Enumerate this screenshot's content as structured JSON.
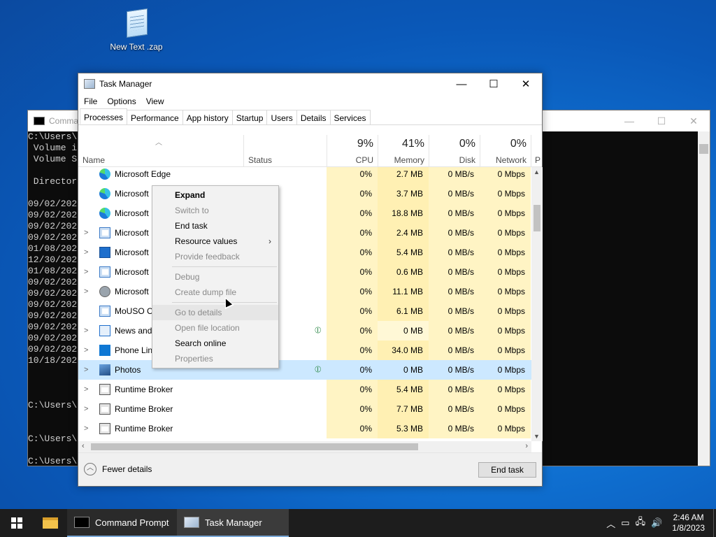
{
  "desktop": {
    "icon_label": "New Text .zap"
  },
  "cmd": {
    "title": "Comma",
    "lines": [
      "C:\\Users\\",
      " Volume i",
      " Volume S",
      "",
      " Director",
      "",
      "09/02/202",
      "09/02/202",
      "09/02/202",
      "09/02/202",
      "01/08/202",
      "12/30/202",
      "01/08/202",
      "09/02/202",
      "09/02/202",
      "09/02/202",
      "09/02/202",
      "09/02/202",
      "09/02/202",
      "09/02/202",
      "10/18/202",
      "",
      "",
      "",
      "C:\\Users\\",
      "",
      "",
      "C:\\Users\\",
      "",
      "C:\\Users\\"
    ]
  },
  "taskmanager": {
    "title": "Task Manager",
    "menu": [
      "File",
      "Options",
      "View"
    ],
    "tabs": [
      "Processes",
      "Performance",
      "App history",
      "Startup",
      "Users",
      "Details",
      "Services"
    ],
    "columns": {
      "name": "Name",
      "status": "Status",
      "cpu_pct": "9%",
      "cpu": "CPU",
      "mem_pct": "41%",
      "mem": "Memory",
      "disk_pct": "0%",
      "disk": "Disk",
      "net_pct": "0%",
      "net": "Network",
      "power": "P"
    },
    "rows": [
      {
        "name": "Microsoft Edge",
        "icon": "edge-icon",
        "expand": false,
        "leaf": false,
        "cpu": "0%",
        "mem": "2.7 MB",
        "disk": "0 MB/s",
        "net": "0 Mbps"
      },
      {
        "name": "Microsoft",
        "icon": "edge-icon",
        "expand": false,
        "leaf": false,
        "cpu": "0%",
        "mem": "3.7 MB",
        "disk": "0 MB/s",
        "net": "0 Mbps"
      },
      {
        "name": "Microsoft",
        "icon": "edge-icon",
        "expand": false,
        "leaf": false,
        "cpu": "0%",
        "mem": "18.8 MB",
        "disk": "0 MB/s",
        "net": "0 Mbps"
      },
      {
        "name": "Microsoft",
        "icon": "window-icon",
        "expand": true,
        "leaf": false,
        "cpu": "0%",
        "mem": "2.4 MB",
        "disk": "0 MB/s",
        "net": "0 Mbps"
      },
      {
        "name": "Microsoft",
        "icon": "keyboard-icon",
        "expand": true,
        "leaf": false,
        "cpu": "0%",
        "mem": "5.4 MB",
        "disk": "0 MB/s",
        "net": "0 Mbps"
      },
      {
        "name": "Microsoft",
        "icon": "window-icon",
        "expand": true,
        "leaf": false,
        "cpu": "0%",
        "mem": "0.6 MB",
        "disk": "0 MB/s",
        "net": "0 Mbps"
      },
      {
        "name": "Microsoft",
        "icon": "user-icon",
        "expand": true,
        "leaf": false,
        "cpu": "0%",
        "mem": "11.1 MB",
        "disk": "0 MB/s",
        "net": "0 Mbps"
      },
      {
        "name": "MoUSO C",
        "icon": "window-icon",
        "expand": false,
        "leaf": false,
        "cpu": "0%",
        "mem": "6.1 MB",
        "disk": "0 MB/s",
        "net": "0 Mbps"
      },
      {
        "name": "News and",
        "icon": "search-icon",
        "expand": true,
        "leaf": true,
        "cpu": "0%",
        "mem": "0 MB",
        "disk": "0 MB/s",
        "net": "0 Mbps"
      },
      {
        "name": "Phone Lin",
        "icon": "phone-icon",
        "expand": true,
        "leaf": false,
        "cpu": "0%",
        "mem": "34.0 MB",
        "disk": "0 MB/s",
        "net": "0 Mbps"
      },
      {
        "name": "Photos",
        "icon": "photos-icon",
        "expand": true,
        "leaf": true,
        "cpu": "0%",
        "mem": "0 MB",
        "disk": "0 MB/s",
        "net": "0 Mbps"
      },
      {
        "name": "Runtime Broker",
        "icon": "runtime-icon",
        "expand": true,
        "leaf": false,
        "cpu": "0%",
        "mem": "5.4 MB",
        "disk": "0 MB/s",
        "net": "0 Mbps"
      },
      {
        "name": "Runtime Broker",
        "icon": "runtime-icon",
        "expand": true,
        "leaf": false,
        "cpu": "0%",
        "mem": "7.7 MB",
        "disk": "0 MB/s",
        "net": "0 Mbps"
      },
      {
        "name": "Runtime Broker",
        "icon": "runtime-icon",
        "expand": true,
        "leaf": false,
        "cpu": "0%",
        "mem": "5.3 MB",
        "disk": "0 MB/s",
        "net": "0 Mbps"
      }
    ],
    "selected_row": "Photos",
    "fewer_details": "Fewer details",
    "end_task": "End task"
  },
  "context_menu": {
    "items": [
      {
        "label": "Expand",
        "enabled": true,
        "bold": true
      },
      {
        "label": "Switch to",
        "enabled": false
      },
      {
        "label": "End task",
        "enabled": true
      },
      {
        "label": "Resource values",
        "enabled": true,
        "submenu": true
      },
      {
        "label": "Provide feedback",
        "enabled": false
      },
      {
        "separator": true
      },
      {
        "label": "Debug",
        "enabled": false
      },
      {
        "label": "Create dump file",
        "enabled": false
      },
      {
        "separator": true
      },
      {
        "label": "Go to details",
        "enabled": false,
        "hover": true
      },
      {
        "label": "Open file location",
        "enabled": false
      },
      {
        "label": "Search online",
        "enabled": true
      },
      {
        "label": "Properties",
        "enabled": false
      }
    ]
  },
  "taskbar": {
    "items": [
      "Command Prompt",
      "Task Manager"
    ],
    "active": "Task Manager",
    "time": "2:46 AM",
    "date": "1/8/2023"
  }
}
